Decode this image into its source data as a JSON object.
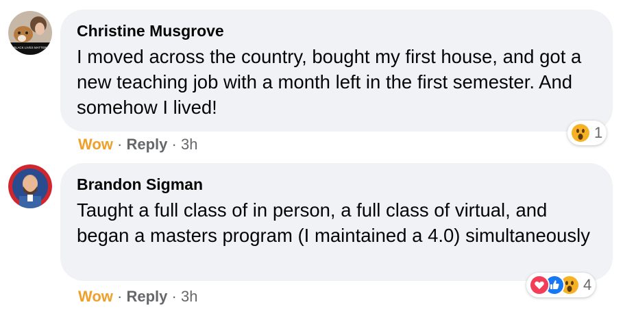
{
  "comments": [
    {
      "author": "Christine Musgrove",
      "text": "I moved across the country, bought my first house, and got a new teaching job with a month left in the first semester. And somehow I lived!",
      "avatar_caption": "BLACK LIVES MATTER",
      "actions": {
        "reaction": "Wow",
        "reply": "Reply",
        "time": "3h",
        "sep": "·"
      },
      "reactions": {
        "icons": [
          "wow-icon"
        ],
        "count": "1"
      }
    },
    {
      "author": "Brandon Sigman",
      "text": "Taught a full class of in person, a full class of virtual, and began a masters program (I maintained a 4.0) simultaneously",
      "actions": {
        "reaction": "Wow",
        "reply": "Reply",
        "time": "3h",
        "sep": "·"
      },
      "reactions": {
        "icons": [
          "love-icon",
          "like-icon",
          "wow-icon"
        ],
        "count": "4"
      }
    }
  ],
  "colors": {
    "bubble": "#f0f2f5",
    "wow": "#f0a02a",
    "meta": "#65676b",
    "love": "#f33e58",
    "like": "#1877f2"
  }
}
